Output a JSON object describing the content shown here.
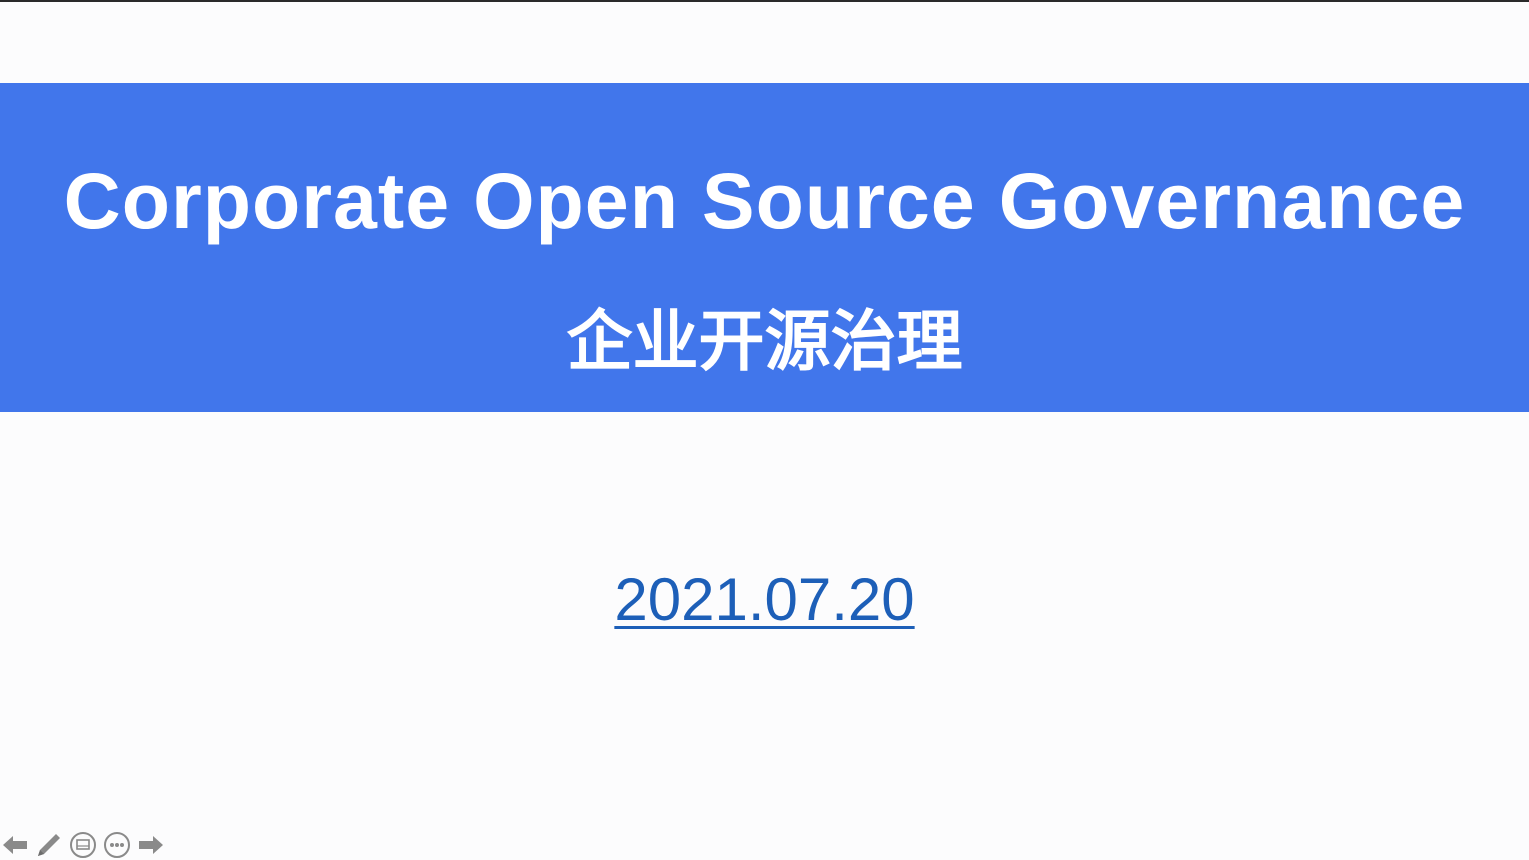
{
  "slide": {
    "title_en": "Corporate Open Source Governance",
    "title_cn": "企业开源治理",
    "date": "2021.07.20"
  },
  "colors": {
    "band": "#4176eb",
    "title_text": "#ffffff",
    "date_link": "#1d5fb8",
    "background": "#fcfcfd",
    "controls": "#8a8a8a"
  },
  "controls": {
    "icons": [
      "arrow-left-icon",
      "pen-icon",
      "slide-view-icon",
      "more-options-icon",
      "arrow-right-icon"
    ]
  }
}
